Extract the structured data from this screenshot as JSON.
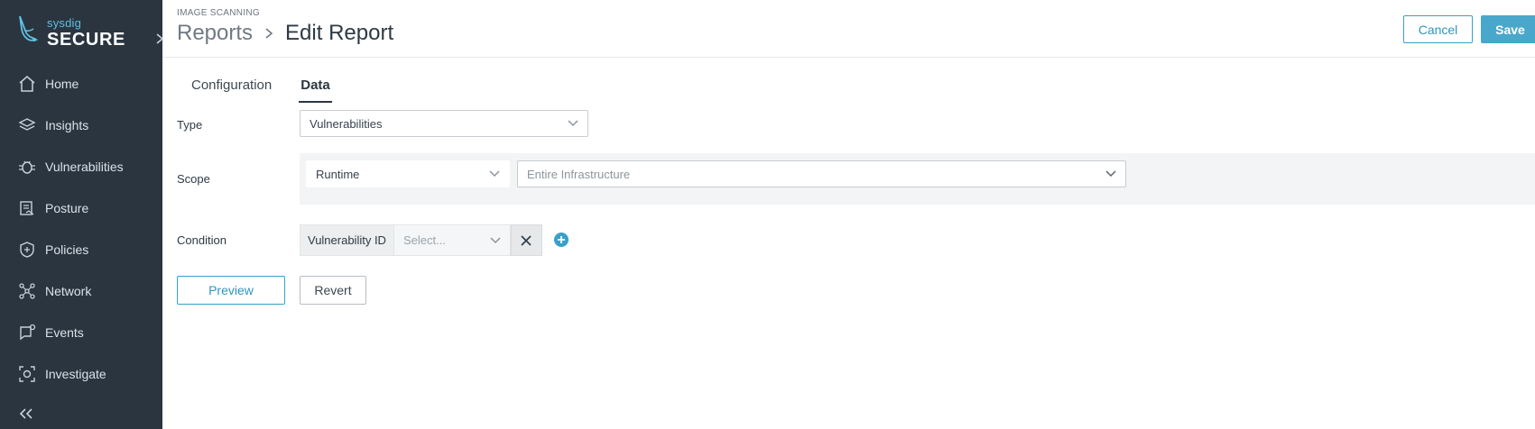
{
  "brand": {
    "top": "sysdig",
    "bottom": "SECURE",
    "accent": "#5fc1df"
  },
  "sidebar": {
    "items": [
      {
        "label": "Home",
        "icon": "home-icon"
      },
      {
        "label": "Insights",
        "icon": "insights-icon"
      },
      {
        "label": "Vulnerabilities",
        "icon": "bug-icon"
      },
      {
        "label": "Posture",
        "icon": "posture-icon"
      },
      {
        "label": "Policies",
        "icon": "shield-icon"
      },
      {
        "label": "Network",
        "icon": "network-icon"
      },
      {
        "label": "Events",
        "icon": "events-icon"
      },
      {
        "label": "Investigate",
        "icon": "investigate-icon"
      }
    ],
    "collapse_icon": "double-chevron-left-icon"
  },
  "header": {
    "eyebrow": "IMAGE SCANNING",
    "breadcrumb": "Reports",
    "title": "Edit Report",
    "cancel_label": "Cancel",
    "save_label": "Save"
  },
  "tabs": [
    {
      "label": "Configuration",
      "active": false
    },
    {
      "label": "Data",
      "active": true
    }
  ],
  "form": {
    "type_label": "Type",
    "type_value": "Vulnerabilities",
    "scope_label": "Scope",
    "scope_env_value": "Runtime",
    "scope_infra_placeholder": "Entire Infrastructure",
    "condition_label": "Condition",
    "condition_field": "Vulnerability ID",
    "condition_placeholder": "Select..."
  },
  "actions": {
    "preview_label": "Preview",
    "revert_label": "Revert"
  },
  "colors": {
    "sidebar_bg": "#2a3540",
    "primary": "#4aa7cc"
  }
}
